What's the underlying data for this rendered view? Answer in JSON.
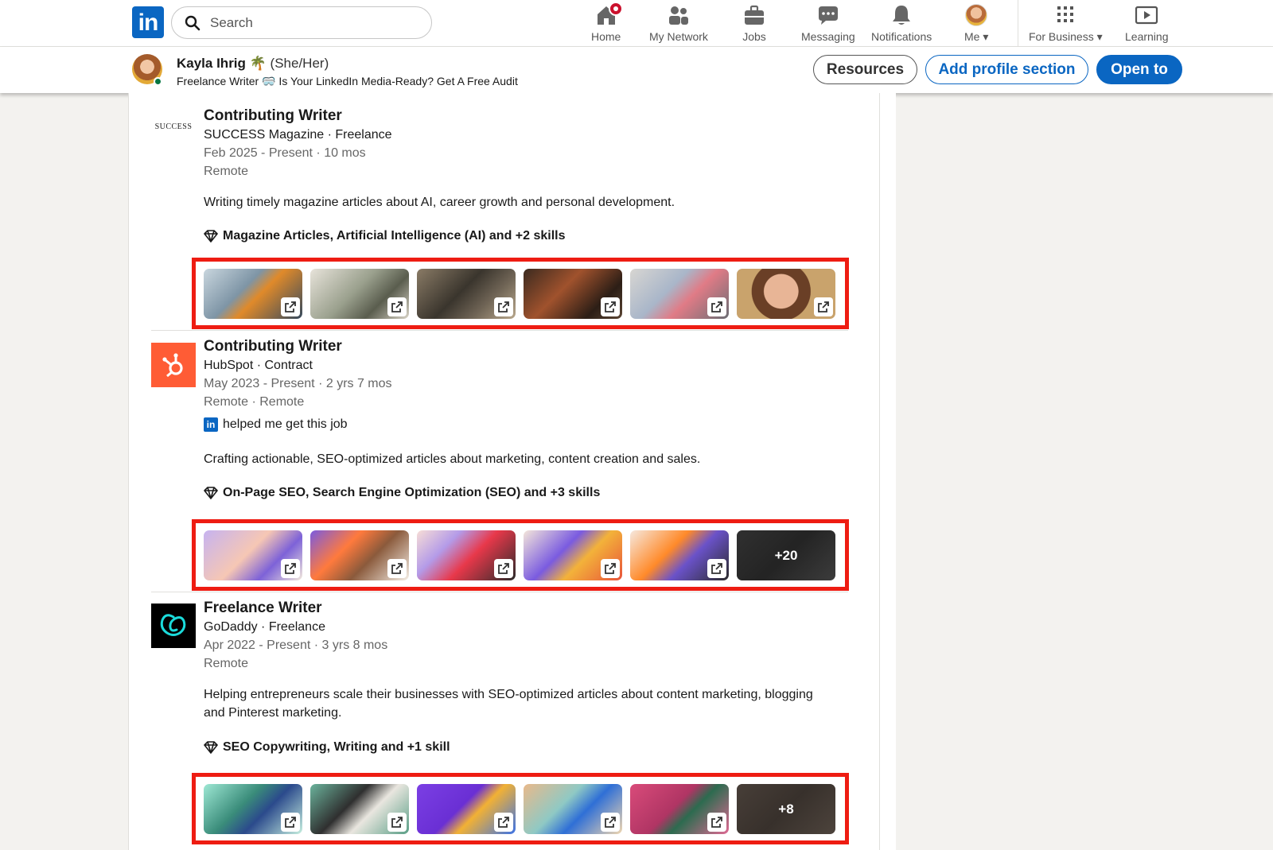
{
  "nav": {
    "search_placeholder": "Search",
    "items": [
      {
        "label": "Home",
        "icon": "home-icon"
      },
      {
        "label": "My Network",
        "icon": "network-icon"
      },
      {
        "label": "Jobs",
        "icon": "briefcase-icon"
      },
      {
        "label": "Messaging",
        "icon": "chat-icon"
      },
      {
        "label": "Notifications",
        "icon": "bell-icon"
      },
      {
        "label": "Me",
        "icon": "avatar"
      },
      {
        "label": "For Business",
        "icon": "grid-icon"
      },
      {
        "label": "Learning",
        "icon": "play-icon"
      }
    ]
  },
  "profile": {
    "name": "Kayla Ihrig 🌴",
    "pronouns": "(She/Her)",
    "headline": "Freelance Writer 🥽 Is Your LinkedIn Media-Ready? Get A Free Audit"
  },
  "actions": {
    "resources": "Resources",
    "add_section": "Add profile section",
    "open_to": "Open to"
  },
  "experience": [
    {
      "title": "Contributing Writer",
      "company": "SUCCESS Magazine · Freelance",
      "logo_text": "SUCCESS",
      "dates": "Feb 2025 - Present · 10 mos",
      "location": "Remote",
      "description": "Writing timely magazine articles about AI, career growth and personal development.",
      "skills": "Magazine Articles, Artificial Intelligence (AI) and +2 skills",
      "media_more": ""
    },
    {
      "title": "Contributing Writer",
      "company": "HubSpot · Contract",
      "dates": "May 2023 - Present · 2 yrs 7 mos",
      "location": "Remote · Remote",
      "helped": "helped me get this job",
      "description": "Crafting actionable, SEO-optimized articles about marketing, content creation and sales.",
      "skills": "On-Page SEO, Search Engine Optimization (SEO) and +3 skills",
      "media_more": "+20"
    },
    {
      "title": "Freelance Writer",
      "company": "GoDaddy · Freelance",
      "dates": "Apr 2022 - Present · 3 yrs 8 mos",
      "location": "Remote",
      "description": "Helping entrepreneurs scale their businesses with SEO-optimized articles about content marketing, blogging and Pinterest marketing.",
      "skills": "SEO Copywriting, Writing and +1 skill",
      "media_more": "+8"
    }
  ],
  "colors": {
    "brand": "#0a66c2",
    "highlight": "#ee1c12",
    "hubspot": "#ff5c35",
    "godaddy": "#000000"
  }
}
